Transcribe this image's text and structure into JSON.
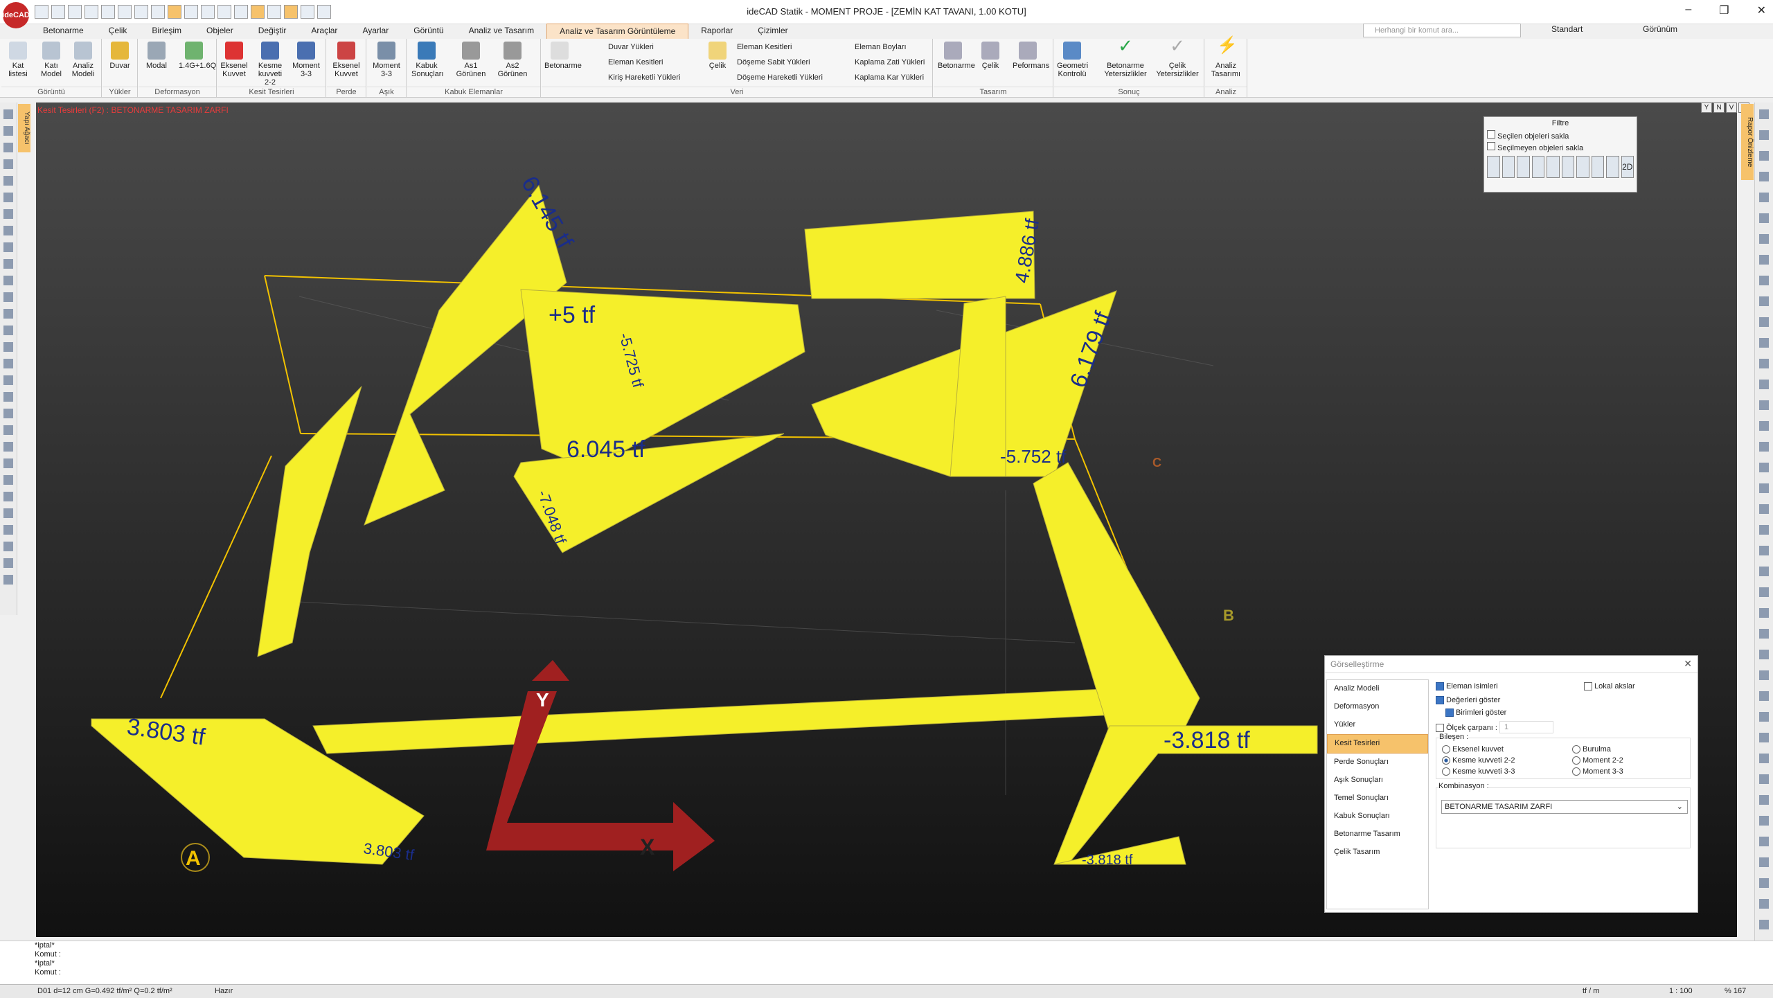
{
  "app": {
    "logo": "ideCAD",
    "title": "ideCAD Statik - MOMENT PROJE - [ZEMİN KAT TAVANI,  1.00 KOTU]"
  },
  "menu": [
    "Betonarme",
    "Çelik",
    "Birleşim",
    "Objeler",
    "Değiştir",
    "Araçlar",
    "Ayarlar",
    "Görüntü",
    "Analiz ve Tasarım",
    "Analiz ve Tasarım Görüntüleme",
    "Raporlar",
    "Çizimler"
  ],
  "search": {
    "placeholder": "Herhangi bir komut ara..."
  },
  "toolbar_right": {
    "style": "Standart",
    "view": "Görünüm"
  },
  "ribbon": {
    "groups": [
      {
        "label": "Görüntü",
        "buttons": [
          "Kat listesi",
          "Katı Model",
          "Analiz Modeli"
        ]
      },
      {
        "label": "Yükler",
        "buttons": [
          "Duvar"
        ]
      },
      {
        "label": "Deformasyon",
        "buttons": [
          "Modal",
          "1.4G+1.6Q"
        ]
      },
      {
        "label": "Kesit Tesirleri",
        "buttons": [
          "Eksenel Kuvvet",
          "Kesme kuvveti 2-2",
          "Moment 3-3"
        ]
      },
      {
        "label": "Perde",
        "buttons": [
          "Eksenel Kuvvet"
        ]
      },
      {
        "label": "Aşık",
        "buttons": [
          "Moment 3-3"
        ]
      },
      {
        "label": "Kabuk Elemanlar",
        "buttons": [
          "Kabuk Sonuçları",
          "As1 Görünen",
          "As2 Görünen"
        ]
      },
      {
        "label": "Veri",
        "buttons": [
          "Betonarme",
          "Çelik"
        ],
        "small": [
          "Duvar Yükleri",
          "Eleman Kesitleri",
          "Kiriş Hareketli Yükleri",
          "Eleman Kesitleri",
          "Döşeme Sabit Yükleri",
          "Döşeme Hareketli Yükleri",
          "Eleman Boyları",
          "Kaplama Zati Yükleri",
          "Kaplama Kar Yükleri"
        ]
      },
      {
        "label": "Tasarım",
        "buttons": [
          "Betonarme",
          "Çelik",
          "Peformans"
        ]
      },
      {
        "label": "Sonuç",
        "buttons": [
          "Geometri Kontrolü",
          "Betonarme Yetersizlikler",
          "Çelik Yetersizlikler"
        ]
      },
      {
        "label": "Analiz",
        "buttons": [
          "Analiz Tasarımı"
        ]
      }
    ]
  },
  "viewport": {
    "title": "Kesit Tesirleri (F2) : BETONARME TASARIM ZARFI",
    "left_tab": "Yapı Ağacı",
    "right_tab": "Rapor Önizleme",
    "labels": [
      "6.145 tf",
      "+5 tf",
      "-5.725 tf",
      "6.045 tf",
      "-7.048 tf",
      "4.886 tf",
      "6.179 tf",
      "-5.752 tf",
      "3.803 tf",
      "3.803 tf",
      "-3.818 tf",
      "-3.818 tf",
      "A",
      "B",
      "C",
      "X",
      "Y"
    ],
    "window_buttons": [
      "Y",
      "N",
      "V",
      "X"
    ]
  },
  "filter": {
    "title": "Filtre",
    "opt1": "Seçilen objeleri sakla",
    "opt2": "Seçilmeyen objeleri sakla",
    "mode": "2D"
  },
  "dialog": {
    "title": "Görselleştirme",
    "list": [
      "Analiz Modeli",
      "Deformasyon",
      "Yükler",
      "Kesit Tesirleri",
      "Perde Sonuçları",
      "Aşık Sonuçları",
      "Temel Sonuçları",
      "Kabuk Sonuçları",
      "Betonarme Tasarım",
      "Çelik Tasarım"
    ],
    "cb_names": "Eleman isimleri",
    "cb_axes": "Lokal akslar",
    "cb_values": "Değerleri göster",
    "cb_units": "Birimleri göster",
    "cb_scale": "Ölçek çarpanı :",
    "scale_value": "1",
    "component_label": "Bileşen :",
    "components": [
      "Eksenel kuvvet",
      "Burulma",
      "Kesme kuvveti 2-2",
      "Moment 2-2",
      "Kesme kuvveti 3-3",
      "Moment 3-3"
    ],
    "combo_label": "Kombinasyon :",
    "combo_value": "BETONARME TASARIM ZARFI"
  },
  "command": [
    "*iptal*",
    "Komut :",
    "*iptal*",
    "Komut :"
  ],
  "status": {
    "left": "D01 d=12 cm G=0.492 tf/m² Q=0.2 tf/m²",
    "state": "Hazır",
    "unit": "tf / m",
    "scale": "1 : 100",
    "zoom": "% 167"
  }
}
